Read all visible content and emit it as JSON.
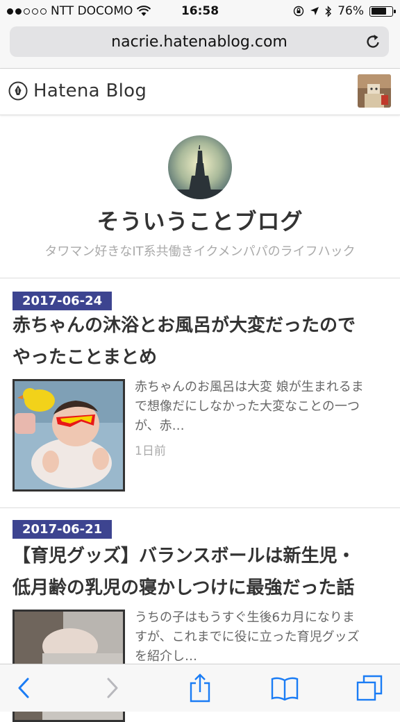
{
  "status_bar": {
    "carrier": "NTT DOCOMO",
    "time": "16:58",
    "battery": "76%",
    "signal_bars": 2,
    "battery_level": 0.76
  },
  "browser": {
    "url": "nacrie.hatenablog.com"
  },
  "hatena": {
    "logo_text": "Hatena Blog"
  },
  "blog": {
    "title": "そういうことブログ",
    "description": "タワマン好きなIT系共働きイクメンパパのライフハック"
  },
  "entries": [
    {
      "date": "2017-06-24",
      "title_line1": "赤ちゃんの沐浴とお風呂が大変だったので",
      "title_line2": "やったことまとめ",
      "summary_line1": "赤ちゃんのお風呂は大変 娘が生まれるま",
      "summary_line2": "で想像だにしなかった大変なことの一つ",
      "summary_line3": "が、赤…",
      "ago": "1日前"
    },
    {
      "date": "2017-06-21",
      "title_line1": "【育児グッズ】バランスボールは新生児・",
      "title_line2": "低月齢の乳児の寝かしつけに最強だった話",
      "summary_line1": "うちの子はもうすぐ生後6カ月になりま",
      "summary_line2": "すが、これまでに役に立った育児グッズ",
      "summary_line3": "を紹介し…"
    }
  ],
  "colors": {
    "date_badge": "#3d4490",
    "ios_blue": "#1a7cf5"
  }
}
